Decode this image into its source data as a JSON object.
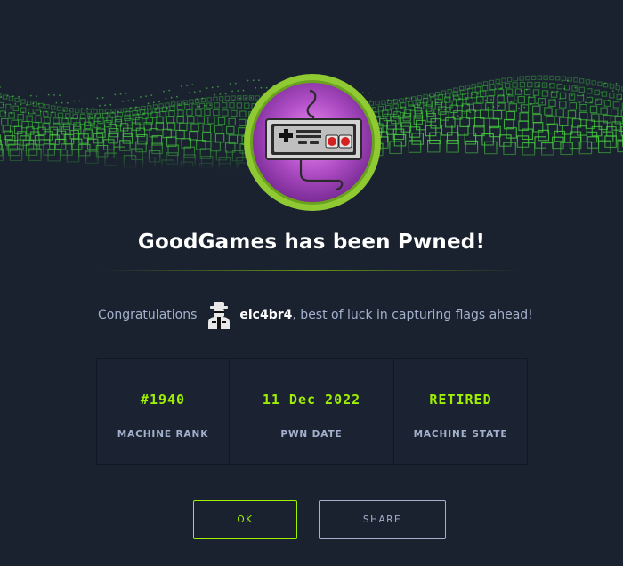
{
  "header": {
    "banner_icon": "green-cube-wave-banner",
    "machine_logo_icon": "gamepad-icon",
    "title": "GoodGames has been Pwned!"
  },
  "congrats": {
    "prefix": "Congratulations",
    "avatar_icon": "hacker-avatar-icon",
    "username": "elc4br4",
    "suffix": ", best of luck in capturing flags ahead!"
  },
  "stats": [
    {
      "value": "#1940",
      "label": "MACHINE RANK"
    },
    {
      "value": "11 Dec 2022",
      "label": "PWN DATE"
    },
    {
      "value": "RETIRED",
      "label": "MACHINE STATE"
    }
  ],
  "buttons": {
    "ok_label": "OK",
    "share_label": "SHARE"
  },
  "colors": {
    "background": "#1a2230",
    "accent": "#9fef00",
    "muted_text": "#a4b1cd",
    "title_text": "#ffffff"
  }
}
